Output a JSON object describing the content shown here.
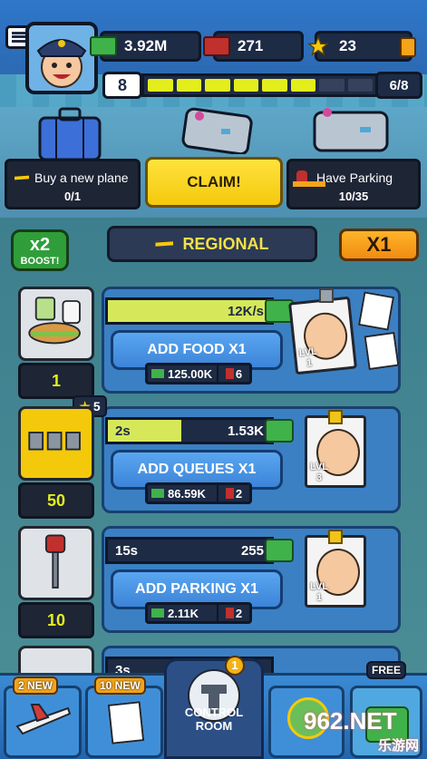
{
  "hud": {
    "cash": "3.92M",
    "passengers": "271",
    "stars": "23",
    "level": "8",
    "xp_progress": "6/8",
    "xp_filled_segments": 6,
    "xp_total_segments": 8
  },
  "quests": [
    {
      "title": "Buy a new plane",
      "progress": "0/1"
    },
    {
      "title": "Have Parking",
      "progress": "10/35"
    }
  ],
  "claim_label": "CLAIM!",
  "boost": {
    "multiplier": "x2",
    "label": "BOOST!"
  },
  "region": "REGIONAL",
  "buy_multiplier": "X1",
  "rows": [
    {
      "name": "food",
      "level": "1",
      "time_label": "",
      "income": "12K/s",
      "fill": 1.0,
      "button": "ADD FOOD X1",
      "cost": "125.00K",
      "staff_cost": "6",
      "manager_level": "LVL 1"
    },
    {
      "name": "queues",
      "level": "50",
      "time_label": "2s",
      "income": "1.53K",
      "fill": 0.45,
      "button": "ADD QUEUES X1",
      "cost": "86.59K",
      "staff_cost": "2",
      "manager_level": "LVL 3",
      "star_badge": "5"
    },
    {
      "name": "parking",
      "level": "10",
      "time_label": "15s",
      "income": "255",
      "fill": 0.0,
      "button": "ADD PARKING X1",
      "cost": "2.11K",
      "staff_cost": "2",
      "manager_level": "LVL 1"
    },
    {
      "name": "next",
      "time_label": "3s"
    }
  ],
  "footer": {
    "planes_badge": "2 NEW",
    "staff_badge": "10 NEW",
    "control_room": "CONTROL ROOM",
    "control_room_count": "1",
    "free_label": "FREE"
  },
  "watermark": {
    "logo": "962.NET",
    "sub": "乐游网"
  },
  "colors": {
    "accent_yellow": "#f4c90c",
    "xp_fill": "#e3ee1c",
    "panel_blue": "#3b80c3",
    "cash_green": "#3fb24a"
  }
}
